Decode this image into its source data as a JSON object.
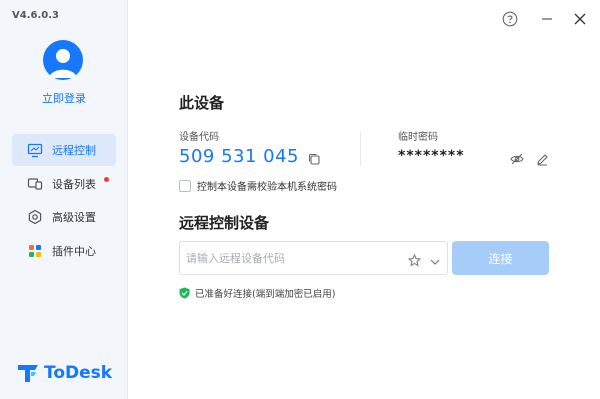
{
  "app": {
    "version": "V4.6.0.3",
    "brand_name": "ToDesk",
    "accent_color": "#1677ff"
  },
  "sidebar": {
    "login_label": "立即登录",
    "items": [
      {
        "label": "远程控制",
        "icon": "monitor-icon",
        "active": true
      },
      {
        "label": "设备列表",
        "icon": "devices-icon",
        "badge": "red-dot"
      },
      {
        "label": "高级设置",
        "icon": "settings-hex-icon"
      },
      {
        "label": "插件中心",
        "icon": "plugin-grid-icon"
      }
    ]
  },
  "window_controls": {
    "help": "question-circle-icon",
    "minimize": "minimize-icon",
    "close": "close-icon"
  },
  "this_device": {
    "title": "此设备",
    "code_label": "设备代码",
    "code_value": "509 531 045",
    "temp_pass_label": "临时密码",
    "temp_pass_value": "********",
    "verify_checkbox_label": "控制本设备需校验本机系统密码"
  },
  "remote": {
    "title": "远程控制设备",
    "input_placeholder": "请输入远程设备代码",
    "input_value": "",
    "connect_label": "连接",
    "status_text": "已准备好连接(端到端加密已启用)"
  }
}
